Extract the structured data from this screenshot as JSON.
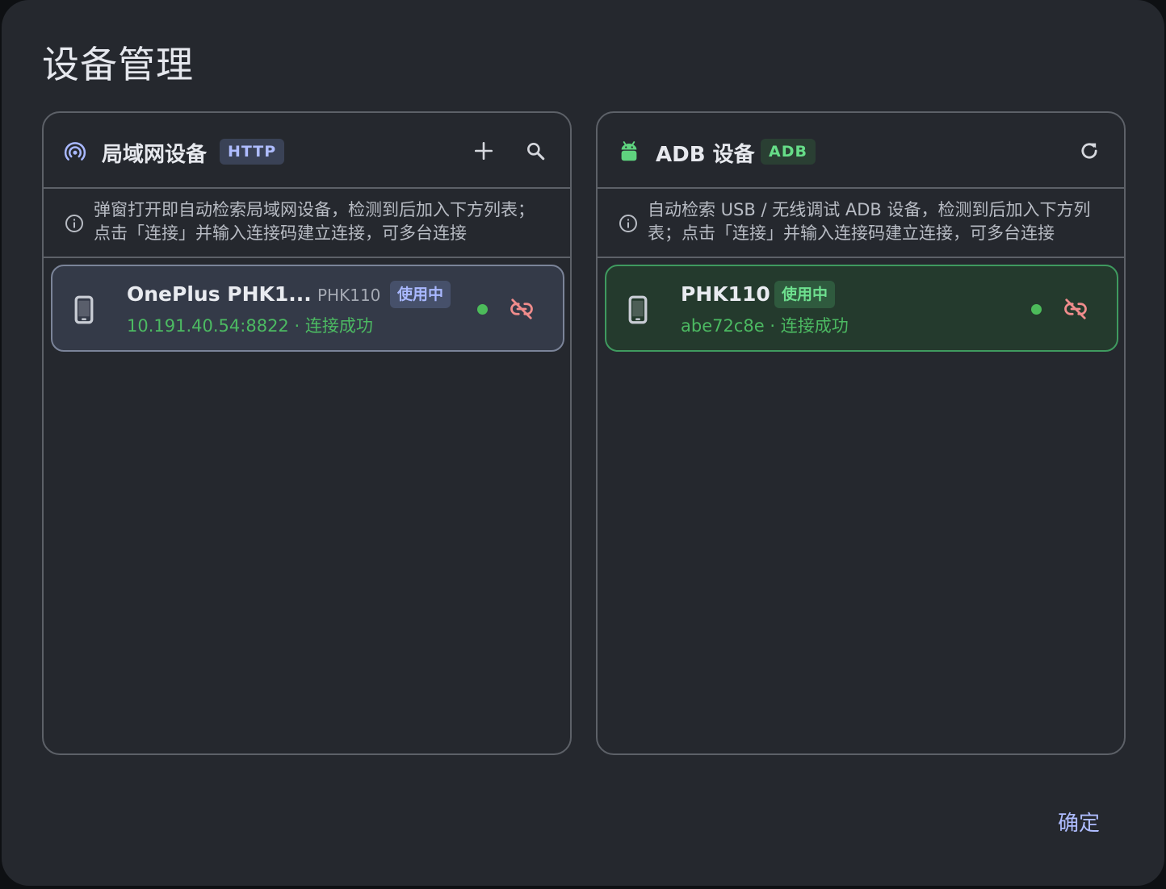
{
  "dialog": {
    "title": "设备管理",
    "confirm_label": "确定"
  },
  "lan_panel": {
    "title": "局域网设备",
    "badge": "HTTP",
    "icon": "wifi-tethering-icon",
    "actions": [
      "add-icon",
      "search-icon"
    ],
    "info": "弹窗打开即自动检索局域网设备，检测到后加入下方列表；点击「连接」并输入连接码建立连接，可多台连接",
    "device": {
      "name": "OnePlus PHK1...",
      "model": "PHK110",
      "status_badge": "使用中",
      "subtitle": "10.191.40.54:8822 · 连接成功"
    }
  },
  "adb_panel": {
    "title": "ADB 设备",
    "badge": "ADB",
    "icon": "android-icon",
    "actions": [
      "refresh-icon"
    ],
    "info": "自动检索 USB / 无线调试 ADB 设备，检测到后加入下方列表；点击「连接」并输入连接码建立连接，可多台连接",
    "device": {
      "name": "PHK110",
      "status_badge": "使用中",
      "subtitle": "abe72c8e · 连接成功"
    }
  },
  "colors": {
    "accent": "#aebcff",
    "success": "#4cba62",
    "danger": "#f08c8c",
    "surface": "#25282e"
  }
}
